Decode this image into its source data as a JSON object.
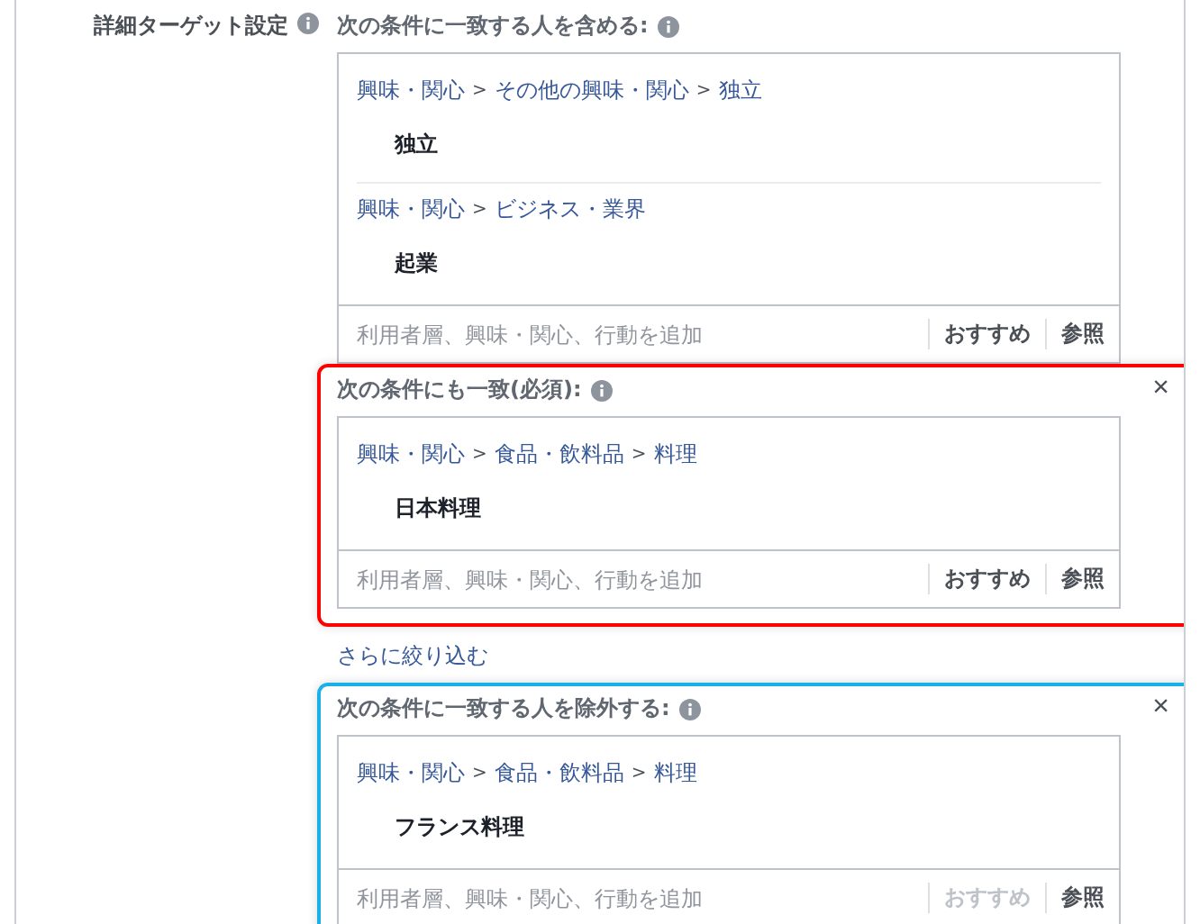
{
  "label": "詳細ターゲット設定",
  "sections": [
    {
      "heading": "次の条件に一致する人を含める:",
      "entries": [
        {
          "path": [
            {
              "kind": "link",
              "text": "興味・関心"
            },
            {
              "kind": "sep",
              "text": ">"
            },
            {
              "kind": "link",
              "text": "その他の興味・関心"
            },
            {
              "kind": "sep",
              "text": ">"
            },
            {
              "kind": "link",
              "text": "独立"
            }
          ],
          "item": "独立"
        },
        {
          "path": [
            {
              "kind": "link",
              "text": "興味・関心"
            },
            {
              "kind": "sep",
              "text": ">"
            },
            {
              "kind": "link",
              "text": "ビジネス・業界"
            }
          ],
          "item": "起業"
        }
      ],
      "placeholder": "利用者層、興味・関心、行動を追加",
      "suggest": {
        "label": "おすすめ",
        "disabled": false
      },
      "browse": "参照"
    },
    {
      "heading": "次の条件にも一致(必須):",
      "close": "×",
      "color": "#ff0000",
      "entries": [
        {
          "path": [
            {
              "kind": "link",
              "text": "興味・関心"
            },
            {
              "kind": "sep",
              "text": ">"
            },
            {
              "kind": "link",
              "text": "食品・飲料品"
            },
            {
              "kind": "sep",
              "text": ">"
            },
            {
              "kind": "link",
              "text": "料理"
            }
          ],
          "item": "日本料理"
        }
      ],
      "placeholder": "利用者層、興味・関心、行動を追加",
      "suggest": {
        "label": "おすすめ",
        "disabled": false
      },
      "browse": "参照"
    }
  ],
  "narrow_link": "さらに絞り込む",
  "exclude": {
    "heading": "次の条件に一致する人を除外する:",
    "close": "×",
    "color": "#1ab0e8",
    "entries": [
      {
        "path": [
          {
            "kind": "link",
            "text": "興味・関心"
          },
          {
            "kind": "sep",
            "text": ">"
          },
          {
            "kind": "link",
            "text": "食品・飲料品"
          },
          {
            "kind": "sep",
            "text": ">"
          },
          {
            "kind": "link",
            "text": "料理"
          }
        ],
        "item": "フランス料理"
      }
    ],
    "placeholder": "利用者層、興味・関心、行動を追加",
    "suggest": {
      "label": "おすすめ",
      "disabled": true
    },
    "browse": "参照"
  }
}
